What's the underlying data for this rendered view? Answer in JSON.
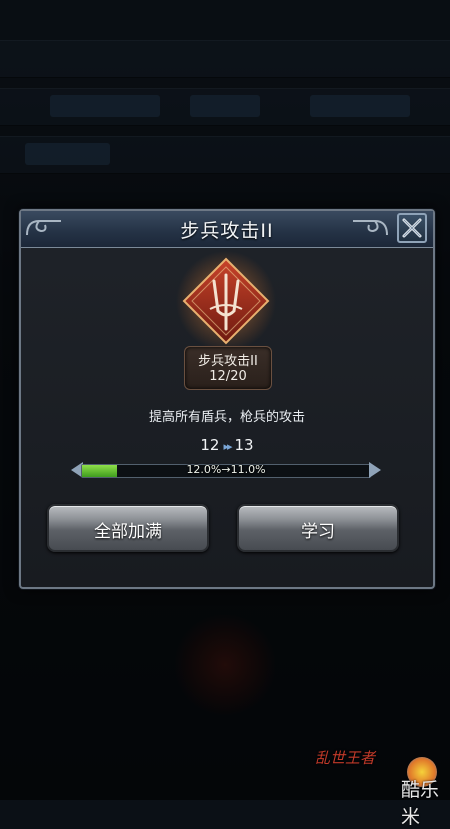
{
  "dialog": {
    "title": "步兵攻击II",
    "skill_name": "步兵攻击II",
    "skill_level": "12/20",
    "description": "提高所有盾兵，枪兵的攻击",
    "level_from": "12",
    "level_to": "13",
    "progress_text": "12.0%→11.0%",
    "progress_fraction": 0.12,
    "buttons": {
      "max_all": "全部加满",
      "learn": "学习"
    }
  },
  "watermark": {
    "game_logo": "乱世王者",
    "site": "酷乐米"
  },
  "colors": {
    "progress_green": "#6cc532",
    "title_bar": "#2a3a50",
    "emblem_red": "#a8321e"
  },
  "icons": {
    "close": "close-x-icon",
    "skill": "trident-skill-icon"
  }
}
